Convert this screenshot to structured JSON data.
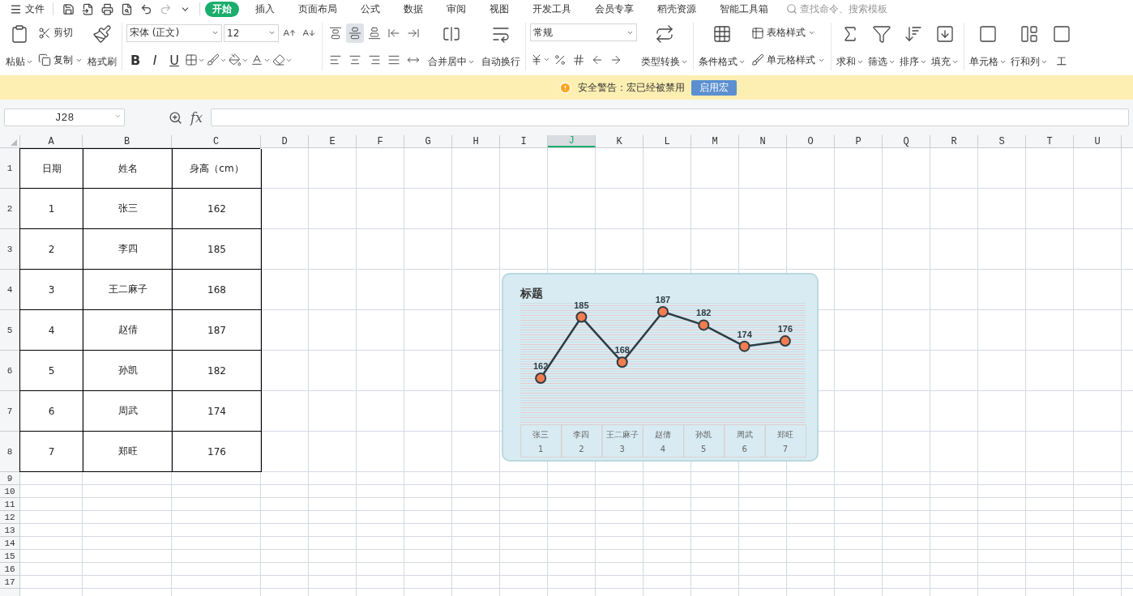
{
  "menu_bar": {
    "file_menu": "文件",
    "tabs": [
      {
        "label": "开始",
        "selected": true
      },
      {
        "label": "插入",
        "selected": false
      },
      {
        "label": "页面布局",
        "selected": false
      },
      {
        "label": "公式",
        "selected": false
      },
      {
        "label": "数据",
        "selected": false
      },
      {
        "label": "审阅",
        "selected": false
      },
      {
        "label": "视图",
        "selected": false
      },
      {
        "label": "开发工具",
        "selected": false
      },
      {
        "label": "会员专享",
        "selected": false
      },
      {
        "label": "稻壳资源",
        "selected": false
      },
      {
        "label": "智能工具箱",
        "selected": false
      }
    ],
    "search": {
      "placeholder": "查找命令、搜索模板"
    }
  },
  "ribbon": {
    "clipboard": {
      "paste": "粘贴",
      "cut": "剪切",
      "copy": "复制",
      "format_painter": "格式刷"
    },
    "font": {
      "font_name": "宋体 (正文)",
      "font_size": "12",
      "bold": "B",
      "italic": "I",
      "underline": "U"
    },
    "alignment": {
      "vertical_align_buttons": [
        {
          "selected": false
        },
        {
          "selected": true
        },
        {
          "selected": false
        }
      ],
      "merge_center": "合并居中",
      "wrap_text": "自动换行"
    },
    "number": {
      "format": "常规",
      "convert": "类型转换"
    },
    "styles": {
      "conditional_format": "条件格式",
      "table_style": "表格样式",
      "cell_style": "单元格样式"
    },
    "editing": [
      "求和",
      "筛选",
      "排序",
      "填充"
    ],
    "cells": [
      "单元格",
      "行和列",
      "工"
    ]
  },
  "security_bar": {
    "message": "安全警告：宏已经被禁用",
    "button": "启用宏"
  },
  "formula_bar": {
    "name_box": "J28",
    "fx": "fx"
  },
  "sheet": {
    "columns": [
      {
        "label": "A",
        "selected": false
      },
      {
        "label": "B",
        "selected": false
      },
      {
        "label": "C",
        "selected": false
      },
      {
        "label": "D",
        "selected": false
      },
      {
        "label": "E",
        "selected": false
      },
      {
        "label": "F",
        "selected": false
      },
      {
        "label": "G",
        "selected": false
      },
      {
        "label": "H",
        "selected": false
      },
      {
        "label": "I",
        "selected": false
      },
      {
        "label": "J",
        "selected": true
      },
      {
        "label": "K",
        "selected": false
      },
      {
        "label": "L",
        "selected": false
      },
      {
        "label": "M",
        "selected": false
      },
      {
        "label": "N",
        "selected": false
      },
      {
        "label": "O",
        "selected": false
      },
      {
        "label": "P",
        "selected": false
      },
      {
        "label": "Q",
        "selected": false
      },
      {
        "label": "R",
        "selected": false
      },
      {
        "label": "S",
        "selected": false
      },
      {
        "label": "T",
        "selected": false
      },
      {
        "label": "U",
        "selected": false
      }
    ],
    "rows": [
      {
        "number": "1",
        "cells": [
          "日期",
          "姓名",
          "身高（cm）"
        ]
      },
      {
        "number": "2",
        "cells": [
          "1",
          "张三",
          "162"
        ]
      },
      {
        "number": "3",
        "cells": [
          "2",
          "李四",
          "185"
        ]
      },
      {
        "number": "4",
        "cells": [
          "3",
          "王二麻子",
          "168"
        ]
      },
      {
        "number": "5",
        "cells": [
          "4",
          "赵倩",
          "187"
        ]
      },
      {
        "number": "6",
        "cells": [
          "5",
          "孙凯",
          "182"
        ]
      },
      {
        "number": "7",
        "cells": [
          "6",
          "周武",
          "174"
        ]
      },
      {
        "number": "8",
        "cells": [
          "7",
          "郑旺",
          "176"
        ]
      },
      {
        "number": "9"
      },
      {
        "number": "10"
      },
      {
        "number": "11"
      },
      {
        "number": "12"
      },
      {
        "number": "13"
      },
      {
        "number": "14"
      },
      {
        "number": "15"
      },
      {
        "number": "16"
      },
      {
        "number": "17"
      }
    ]
  },
  "chart": {
    "title": "标题",
    "index_labels": [
      "1",
      "2",
      "3",
      "4",
      "5",
      "6",
      "7"
    ],
    "chart_data": {
      "type": "line",
      "categories": [
        "张三",
        "李四",
        "王二麻子",
        "赵倩",
        "孙凯",
        "周武",
        "郑旺"
      ],
      "series": [
        {
          "color": "#2e3d45",
          "marker": "circle",
          "values": [
            162,
            185,
            168,
            187,
            182,
            174,
            176
          ]
        }
      ],
      "data_labels": true
    }
  }
}
